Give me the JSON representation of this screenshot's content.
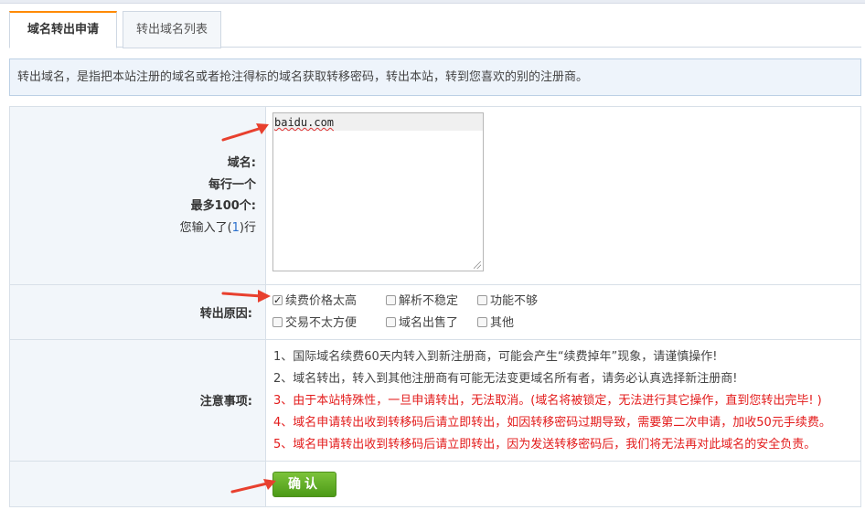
{
  "tabs": [
    {
      "label": "域名转出申请",
      "active": true
    },
    {
      "label": "转出域名列表",
      "active": false
    }
  ],
  "notice": "转出域名，是指把本站注册的域名或者抢注得标的域名获取转移密码，转出本站，转到您喜欢的别的注册商。",
  "domains": {
    "label": "域名:",
    "hint_line1": "每行一个",
    "hint_line2": "最多100个:",
    "count_prefix": "您输入了(",
    "count": "1",
    "count_suffix": ")行",
    "textarea_value": "baidu.com"
  },
  "reason": {
    "label": "转出原因:",
    "options": [
      {
        "label": "续费价格太高",
        "checked": true
      },
      {
        "label": "解析不稳定",
        "checked": false
      },
      {
        "label": "功能不够",
        "checked": false
      },
      {
        "label": "交易不太方便",
        "checked": false
      },
      {
        "label": "域名出售了",
        "checked": false
      },
      {
        "label": "其他",
        "checked": false
      }
    ]
  },
  "notes": {
    "label": "注意事项:",
    "items": [
      {
        "text": "1、国际域名续费60天内转入到新注册商，可能会产生“续费掉年”现象，请谨慎操作!",
        "color": "normal"
      },
      {
        "text": "2、域名转出，转入到其他注册商有可能无法变更域名所有者，请务必认真选择新注册商!",
        "color": "normal"
      },
      {
        "text": "3、由于本站特殊性，一旦申请转出，无法取消。(域名将被锁定，无法进行其它操作，直到您转出完毕! )",
        "color": "red"
      },
      {
        "text": "4、域名申请转出收到转移码后请立即转出，如因转移密码过期导致，需要第二次申请，加收50元手续费。",
        "color": "red"
      },
      {
        "text": "5、域名申请转出收到转移码后请立即转出，因为发送转移密码后，我们将无法再对此域名的安全负责。",
        "color": "red"
      }
    ]
  },
  "submit_label": "确认",
  "colors": {
    "accent_tab": "#ff8a00",
    "warning_red": "#e31b1b",
    "button_green": "#5aa822",
    "arrow_red": "#e8402e"
  }
}
